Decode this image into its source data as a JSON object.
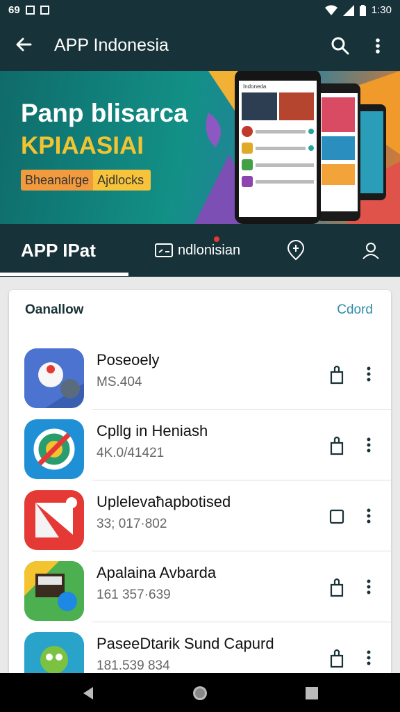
{
  "status_bar": {
    "left_text": "69",
    "time": "1:30",
    "icons": [
      "image-icon",
      "chart-icon",
      "wifi-icon",
      "signal-icon",
      "battery-icon"
    ]
  },
  "app_bar": {
    "title": "APP Indonesia",
    "back_icon": "arrow-left-icon",
    "search_icon": "search-icon",
    "more_icon": "more-vert-icon"
  },
  "banner": {
    "headline": "Panp blisarca",
    "subheadline": "KPIAASIAI",
    "pill_left": "Bheanalrge",
    "pill_right": "Ajdlocks",
    "phone_header": "Indoneda"
  },
  "tabs": [
    {
      "label": "APP IPat",
      "active": true
    },
    {
      "label": "ndlonisian",
      "icon": "id-card-icon",
      "badge": true
    },
    {
      "label": "",
      "icon": "location-icon"
    },
    {
      "label": "",
      "icon": "person-icon"
    }
  ],
  "card": {
    "heading": "Oanallow",
    "link": "Cdord"
  },
  "apps": [
    {
      "name": "Poseoely",
      "meta": "MS.404",
      "action_icon": "share-icon",
      "color": "#3a5fb0"
    },
    {
      "name": "Cpllg in Heniash",
      "meta": "4K.0/41421",
      "action_icon": "share-icon",
      "color": "#1f8fd6"
    },
    {
      "name": "Uplelevaħapbotised",
      "meta": "33; 017·802",
      "action_icon": "square-icon",
      "color": "#e53935"
    },
    {
      "name": "Apalaina Avbarda",
      "meta": "161 357·639",
      "action_icon": "share-icon",
      "color": "#43a047"
    },
    {
      "name": "PaseeDtarik Sund Capurd",
      "meta": "181.539 834",
      "action_icon": "share-icon",
      "color": "#29a3c9"
    }
  ],
  "colors": {
    "bar": "#173238",
    "accent": "#2b8ca8",
    "banner_yellow": "#f4c430"
  }
}
